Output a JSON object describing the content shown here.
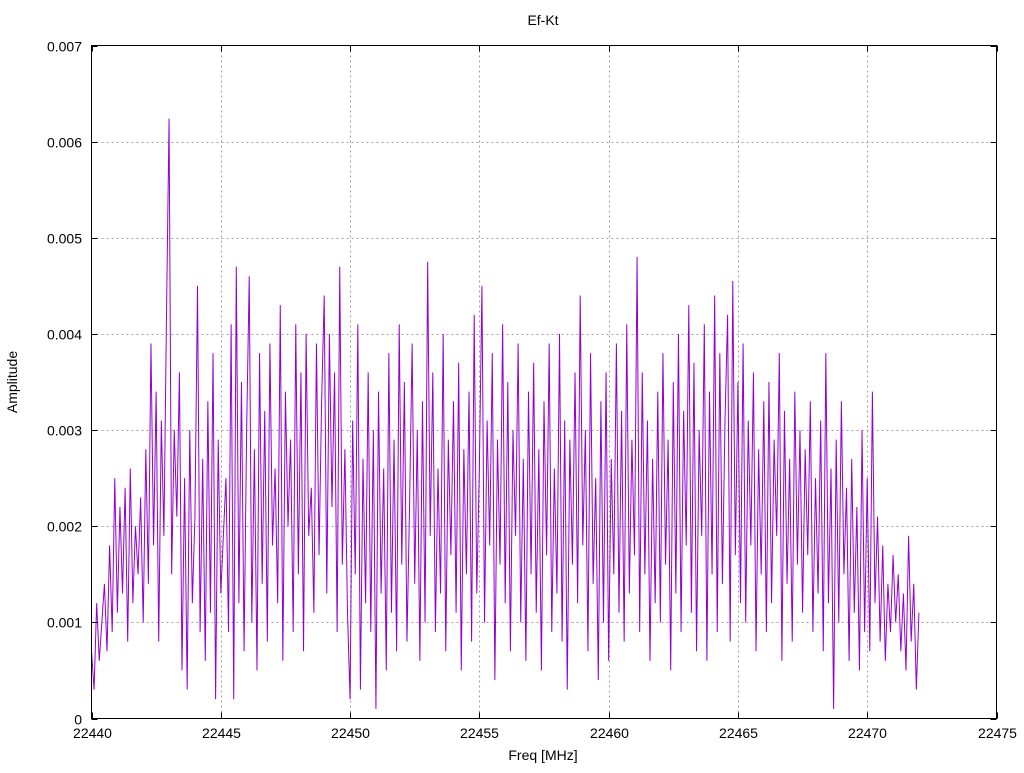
{
  "chart_data": {
    "type": "line",
    "title": "Ef-Kt",
    "xlabel": "Freq [MHz]",
    "ylabel": "Amplitude",
    "xlim": [
      22440,
      22475
    ],
    "ylim": [
      0,
      0.007
    ],
    "xticks": [
      22440,
      22445,
      22450,
      22455,
      22460,
      22465,
      22470,
      22475
    ],
    "yticks": [
      0,
      0.001,
      0.002,
      0.003,
      0.004,
      0.005,
      0.006,
      0.007
    ],
    "ytick_labels": [
      "0",
      "0.001",
      "0.002",
      "0.003",
      "0.004",
      "0.005",
      "0.006",
      "0.007"
    ],
    "grid": true,
    "legend": "none",
    "series": [
      {
        "name": "Ef-Kt",
        "color": "#9400d3",
        "x_start": 22440,
        "x_step": 0.1,
        "values": [
          0.0007,
          0.0003,
          0.0012,
          0.0006,
          0.001,
          0.0014,
          0.0007,
          0.0018,
          0.0009,
          0.0025,
          0.0011,
          0.0022,
          0.0013,
          0.0024,
          0.0008,
          0.0026,
          0.0012,
          0.002,
          0.0015,
          0.0023,
          0.001,
          0.0028,
          0.0014,
          0.0039,
          0.0018,
          0.0034,
          0.0008,
          0.0031,
          0.0019,
          0.0042,
          0.00624,
          0.0015,
          0.003,
          0.0021,
          0.0036,
          0.0005,
          0.0025,
          0.0003,
          0.003,
          0.0012,
          0.0021,
          0.0045,
          0.0009,
          0.0027,
          0.0006,
          0.0033,
          0.0011,
          0.0038,
          0.0002,
          0.0029,
          0.0013,
          0.0019,
          0.0025,
          0.0009,
          0.0041,
          0.0002,
          0.0047,
          0.0012,
          0.0035,
          0.0007,
          0.003,
          0.0046,
          0.001,
          0.0028,
          0.0005,
          0.0038,
          0.0014,
          0.0032,
          0.0008,
          0.0039,
          0.0018,
          0.0026,
          0.0012,
          0.0043,
          0.0006,
          0.0034,
          0.002,
          0.0029,
          0.0009,
          0.0041,
          0.0015,
          0.0036,
          0.0007,
          0.004,
          0.0019,
          0.0024,
          0.0011,
          0.0039,
          0.0017,
          0.0033,
          0.0044,
          0.0013,
          0.004,
          0.0022,
          0.0036,
          0.0009,
          0.0047,
          0.0016,
          0.0028,
          0.0011,
          0.0002,
          0.0031,
          0.0015,
          0.0041,
          0.0003,
          0.0027,
          0.0012,
          0.0036,
          0.0009,
          0.003,
          0.0001,
          0.0034,
          0.0013,
          0.0026,
          0.0005,
          0.0038,
          0.0011,
          0.0029,
          0.0007,
          0.0041,
          0.0016,
          0.0035,
          0.0008,
          0.0022,
          0.0039,
          0.0014,
          0.003,
          0.0006,
          0.0033,
          0.001,
          0.00475,
          0.0019,
          0.0036,
          0.0009,
          0.0026,
          0.0013,
          0.004,
          0.0007,
          0.0029,
          0.0017,
          0.0033,
          0.0011,
          0.0037,
          0.0005,
          0.0028,
          0.0015,
          0.0034,
          0.0008,
          0.0042,
          0.0013,
          0.0026,
          0.0045,
          0.001,
          0.0031,
          0.0018,
          0.0038,
          0.0004,
          0.0029,
          0.0016,
          0.0041,
          0.0012,
          0.0035,
          0.0007,
          0.003,
          0.0019,
          0.0039,
          0.001,
          0.0027,
          0.0006,
          0.0034,
          0.0015,
          0.0037,
          0.0011,
          0.0028,
          0.0005,
          0.0033,
          0.0017,
          0.0039,
          0.0009,
          0.0026,
          0.0013,
          0.004,
          0.0008,
          0.0031,
          0.0003,
          0.0029,
          0.0016,
          0.0036,
          0.0012,
          0.0044,
          0.0018,
          0.003,
          0.0007,
          0.0038,
          0.0014,
          0.0025,
          0.0004,
          0.0033,
          0.001,
          0.0036,
          0.0006,
          0.0027,
          0.0015,
          0.0039,
          0.0011,
          0.0032,
          0.0008,
          0.0041,
          0.0013,
          0.0029,
          0.0017,
          0.0048,
          0.0009,
          0.0036,
          0.0015,
          0.0031,
          0.0006,
          0.0027,
          0.0012,
          0.0034,
          0.001,
          0.0038,
          0.0016,
          0.0029,
          0.0005,
          0.0035,
          0.0013,
          0.004,
          0.0009,
          0.0032,
          0.0018,
          0.0043,
          0.0011,
          0.0037,
          0.0007,
          0.003,
          0.0019,
          0.0041,
          0.0006,
          0.0034,
          0.0015,
          0.0044,
          0.0009,
          0.0038,
          0.0014,
          0.0031,
          0.0042,
          0.0008,
          0.00455,
          0.0017,
          0.0035,
          0.0012,
          0.0039,
          0.001,
          0.0031,
          0.0018,
          0.0036,
          0.0007,
          0.0028,
          0.0015,
          0.0033,
          0.0009,
          0.0035,
          0.0012,
          0.0029,
          0.0019,
          0.0038,
          0.0006,
          0.0032,
          0.0014,
          0.0027,
          0.0008,
          0.0034,
          0.0016,
          0.003,
          0.0011,
          0.0028,
          0.0017,
          0.0033,
          0.0009,
          0.0025,
          0.0013,
          0.0031,
          0.0007,
          0.0038,
          0.0012,
          0.0026,
          0.0001,
          0.0029,
          0.001,
          0.0033,
          0.0015,
          0.0024,
          0.0006,
          0.0027,
          0.0011,
          0.0022,
          0.0005,
          0.003,
          0.0009,
          0.0025,
          0.0007,
          0.0034,
          0.0012,
          0.0021,
          0.0008,
          0.0018,
          0.0006,
          0.0014,
          0.0009,
          0.0017,
          0.001,
          0.0015,
          0.0007,
          0.0013,
          0.0005,
          0.0019,
          0.0008,
          0.0014,
          0.0003,
          0.0011
        ]
      }
    ]
  }
}
